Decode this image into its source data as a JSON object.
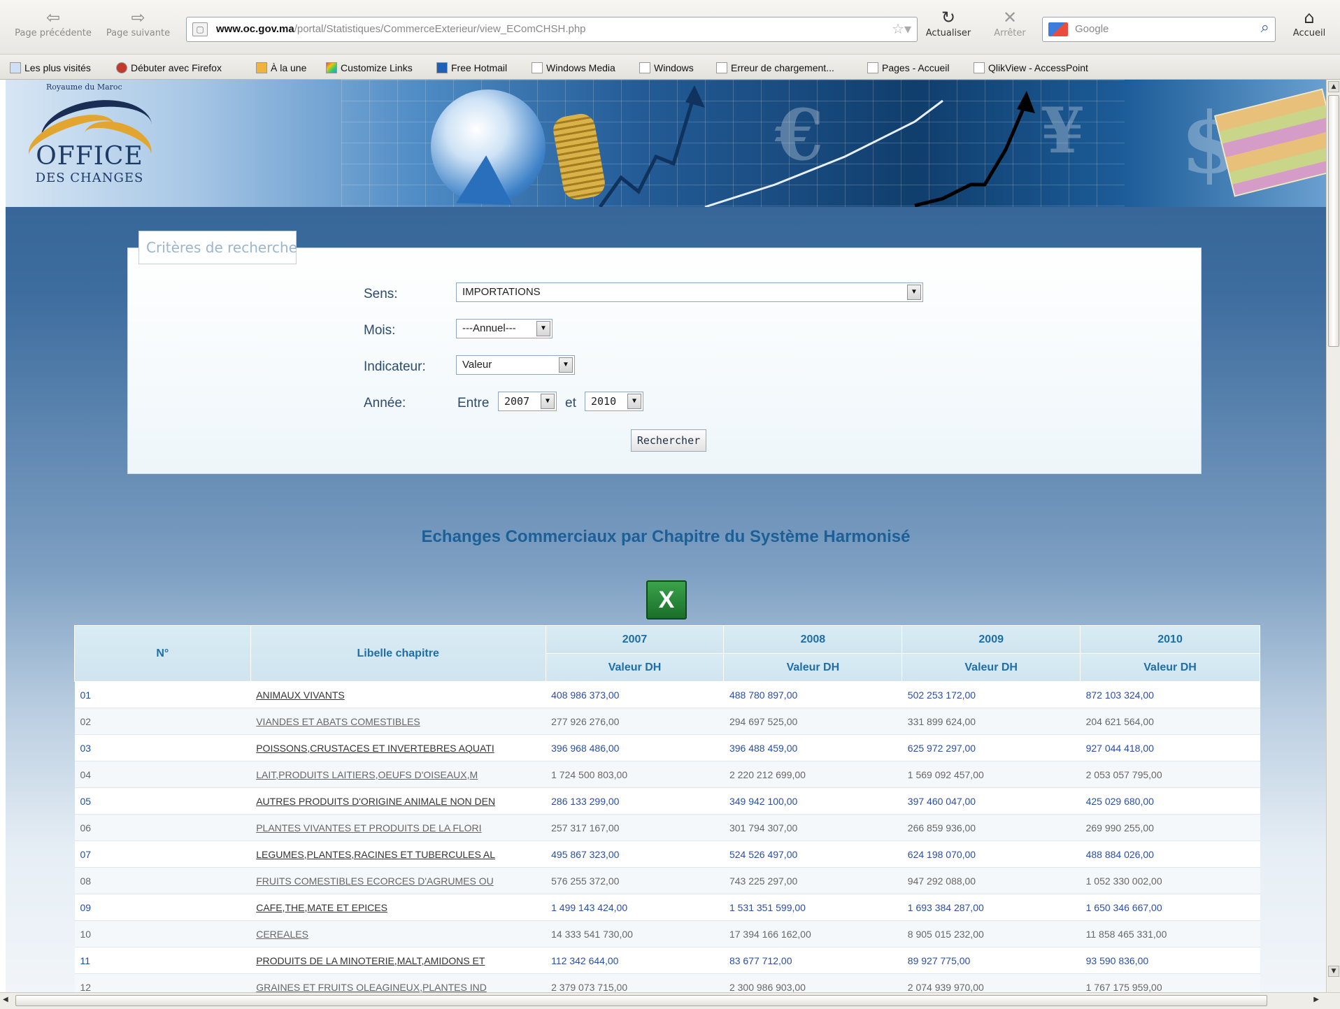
{
  "browser": {
    "back_label": "Page précédente",
    "forward_label": "Page suivante",
    "url_domain": "www.oc.gov.ma",
    "url_path": "/portal/Statistiques/CommerceExterieur/view_EComCHSH.php",
    "reload_label": "Actualiser",
    "stop_label": "Arrêter",
    "search_engine_label": "Google",
    "home_label": "Accueil"
  },
  "bookmarks": [
    "Les plus visités",
    "Débuter avec Firefox",
    "À la une",
    "Customize Links",
    "Free Hotmail",
    "Windows Media",
    "Windows",
    "Erreur de chargement...",
    "Pages - Accueil",
    "QlikView - AccessPoint"
  ],
  "banner": {
    "kingdom": "Royaume du Maroc",
    "logo_line1": "OFFICE",
    "logo_line2": "DES CHANGES"
  },
  "criteria": {
    "legend": "Critères de recherche",
    "sens_label": "Sens:",
    "sens_value": "IMPORTATIONS",
    "mois_label": "Mois:",
    "mois_value": "---Annuel---",
    "indicateur_label": "Indicateur:",
    "indicateur_value": "Valeur",
    "annee_label": "Année:",
    "entre_label": "Entre",
    "year_from": "2007",
    "et_label": "et",
    "year_to": "2010",
    "search_button": "Rechercher"
  },
  "results": {
    "title": "Echanges Commerciaux par Chapitre du Système Harmonisé",
    "columns": {
      "num": "N°",
      "libelle": "Libelle chapitre",
      "years": [
        "2007",
        "2008",
        "2009",
        "2010"
      ],
      "sub": "Valeur DH"
    },
    "rows": [
      {
        "n": "01",
        "libelle": "ANIMAUX VIVANTS",
        "v": [
          "408 986 373,00",
          "488 780 897,00",
          "502 253 172,00",
          "872 103 324,00"
        ]
      },
      {
        "n": "02",
        "libelle": "VIANDES ET ABATS COMESTIBLES",
        "v": [
          "277 926 276,00",
          "294 697 525,00",
          "331 899 624,00",
          "204 621 564,00"
        ]
      },
      {
        "n": "03",
        "libelle": "POISSONS,CRUSTACES ET INVERTEBRES AQUATI",
        "v": [
          "396 968 486,00",
          "396 488 459,00",
          "625 972 297,00",
          "927 044 418,00"
        ]
      },
      {
        "n": "04",
        "libelle": "LAIT,PRODUITS LAITIERS,OEUFS D'OISEAUX,M",
        "v": [
          "1 724 500 803,00",
          "2 220 212 699,00",
          "1 569 092 457,00",
          "2 053 057 795,00"
        ]
      },
      {
        "n": "05",
        "libelle": "AUTRES PRODUITS D'ORIGINE ANIMALE NON DEN",
        "v": [
          "286 133 299,00",
          "349 942 100,00",
          "397 460 047,00",
          "425 029 680,00"
        ]
      },
      {
        "n": "06",
        "libelle": "PLANTES VIVANTES ET PRODUITS DE LA FLORI",
        "v": [
          "257 317 167,00",
          "301 794 307,00",
          "266 859 936,00",
          "269 990 255,00"
        ]
      },
      {
        "n": "07",
        "libelle": "LEGUMES,PLANTES,RACINES ET TUBERCULES AL",
        "v": [
          "495 867 323,00",
          "524 526 497,00",
          "624 198 070,00",
          "488 884 026,00"
        ]
      },
      {
        "n": "08",
        "libelle": "FRUITS COMESTIBLES ECORCES D'AGRUMES OU",
        "v": [
          "576 255 372,00",
          "743 225 297,00",
          "947 292 088,00",
          "1 052 330 002,00"
        ]
      },
      {
        "n": "09",
        "libelle": "CAFE,THE,MATE ET EPICES",
        "v": [
          "1 499 143 424,00",
          "1 531 351 599,00",
          "1 693 384 287,00",
          "1 650 346 667,00"
        ]
      },
      {
        "n": "10",
        "libelle": "CEREALES",
        "v": [
          "14 333 541 730,00",
          "17 394 166 162,00",
          "8 905 015 232,00",
          "11 858 465 331,00"
        ]
      },
      {
        "n": "11",
        "libelle": "PRODUITS DE LA MINOTERIE,MALT,AMIDONS ET",
        "v": [
          "112 342 644,00",
          "83 677 712,00",
          "89 927 775,00",
          "93 590 836,00"
        ]
      },
      {
        "n": "12",
        "libelle": "GRAINES ET FRUITS OLEAGINEUX,PLANTES IND",
        "v": [
          "2 379 073 715,00",
          "2 300 986 903,00",
          "2 074 939 970,00",
          "1 767 175 959,00"
        ]
      }
    ]
  }
}
